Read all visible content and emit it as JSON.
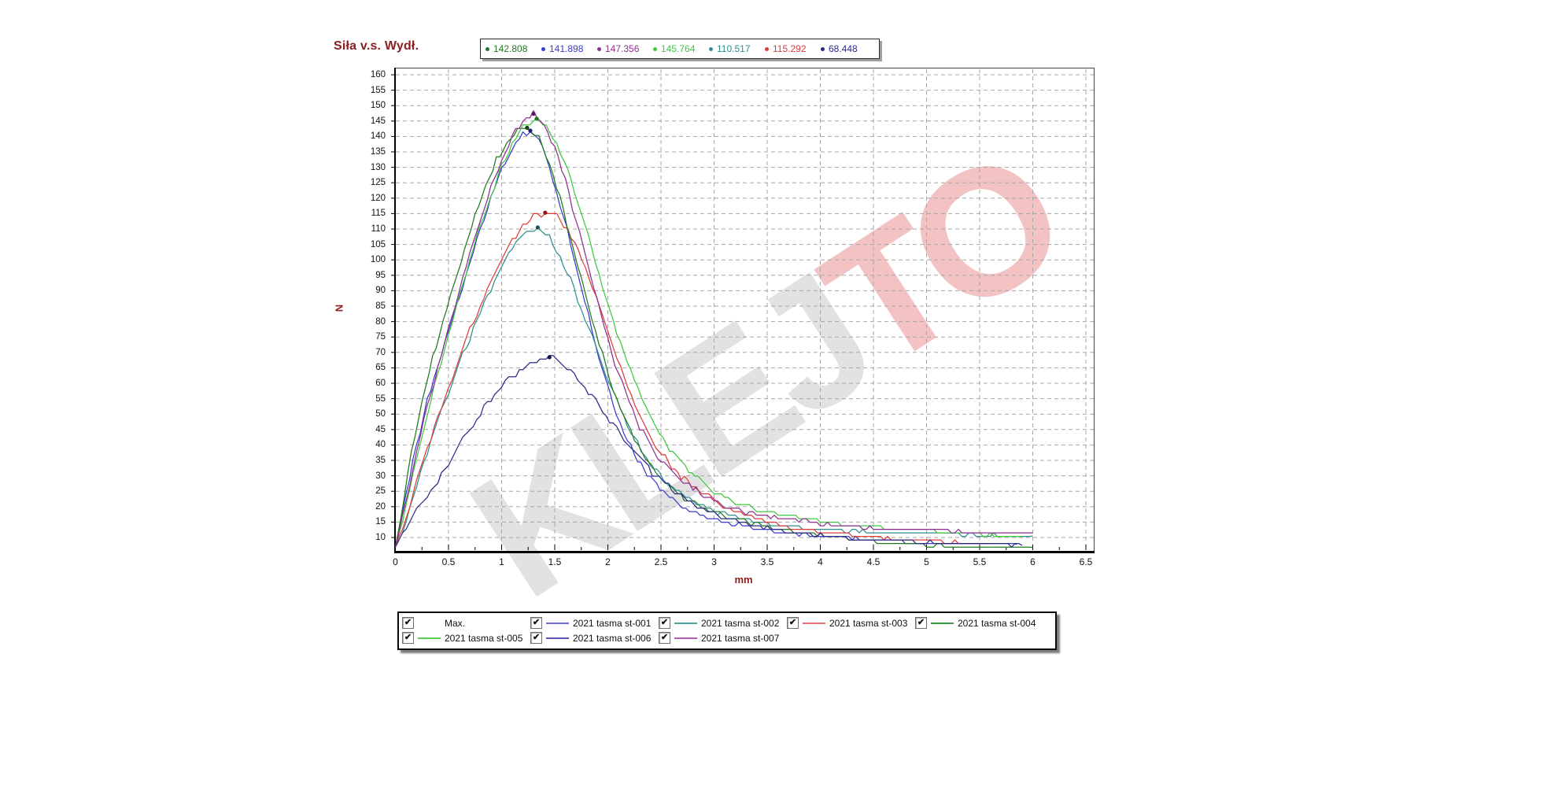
{
  "title": "Siła v.s. Wydł.",
  "values_bar": [
    {
      "value": "142.808",
      "color": "#217821"
    },
    {
      "value": "141.898",
      "color": "#3a3acc"
    },
    {
      "value": "147.356",
      "color": "#8f2f8f"
    },
    {
      "value": "145.764",
      "color": "#3fc93f"
    },
    {
      "value": "110.517",
      "color": "#2f8f8f"
    },
    {
      "value": "115.292",
      "color": "#e03a3a"
    },
    {
      "value": "68.448",
      "color": "#2b2b87"
    }
  ],
  "watermark": {
    "part1": "KLEJ",
    "part2": "TO"
  },
  "chart_data": {
    "type": "line",
    "title": "Siła v.s. Wydł.",
    "xlabel": "mm",
    "ylabel": "N",
    "xlim": [
      0,
      6.6
    ],
    "ylim": [
      5,
      162
    ],
    "grid": "dashed",
    "legend_position": "bottom",
    "x_ticks": [
      0,
      0.5,
      1,
      1.5,
      2,
      2.5,
      3,
      3.5,
      4,
      4.5,
      5,
      5.5,
      6,
      6.5
    ],
    "y_ticks": [
      10,
      15,
      20,
      25,
      30,
      35,
      40,
      45,
      50,
      55,
      60,
      65,
      70,
      75,
      80,
      85,
      90,
      95,
      100,
      105,
      110,
      115,
      120,
      125,
      130,
      135,
      140,
      145,
      150,
      155,
      160
    ],
    "series": [
      {
        "name": "2021 tasma st-001",
        "color": "#3a3acc",
        "marker_color": "#1b1b7a",
        "max": 141.898,
        "peak": [
          1.27,
          141.898
        ],
        "points": [
          [
            0,
            7
          ],
          [
            0.1,
            24
          ],
          [
            0.2,
            40
          ],
          [
            0.3,
            54
          ],
          [
            0.4,
            66
          ],
          [
            0.5,
            77
          ],
          [
            0.6,
            88
          ],
          [
            0.7,
            99
          ],
          [
            0.8,
            110
          ],
          [
            0.9,
            120
          ],
          [
            1.0,
            129
          ],
          [
            1.1,
            136
          ],
          [
            1.2,
            140.5
          ],
          [
            1.27,
            141.9
          ],
          [
            1.35,
            139
          ],
          [
            1.45,
            130
          ],
          [
            1.55,
            118
          ],
          [
            1.65,
            105
          ],
          [
            1.75,
            91
          ],
          [
            1.85,
            77
          ],
          [
            1.95,
            64
          ],
          [
            2.05,
            53
          ],
          [
            2.15,
            44
          ],
          [
            2.25,
            37
          ],
          [
            2.4,
            29
          ],
          [
            2.55,
            24
          ],
          [
            2.7,
            20
          ],
          [
            2.9,
            17
          ],
          [
            3.1,
            15
          ],
          [
            3.4,
            13
          ],
          [
            3.7,
            11.5
          ],
          [
            4.0,
            10.5
          ],
          [
            4.4,
            9.5
          ],
          [
            4.8,
            8.5
          ],
          [
            5.2,
            8
          ],
          [
            5.85,
            7.8
          ]
        ]
      },
      {
        "name": "2021 tasma st-002",
        "color": "#2f8f8f",
        "marker_color": "#1a5555",
        "max": 110.517,
        "peak": [
          1.34,
          110.517
        ],
        "points": [
          [
            0,
            7
          ],
          [
            0.1,
            15
          ],
          [
            0.2,
            27
          ],
          [
            0.3,
            38
          ],
          [
            0.4,
            48
          ],
          [
            0.5,
            57
          ],
          [
            0.6,
            66
          ],
          [
            0.7,
            75
          ],
          [
            0.8,
            83
          ],
          [
            0.9,
            91
          ],
          [
            1.0,
            98
          ],
          [
            1.1,
            104
          ],
          [
            1.2,
            108
          ],
          [
            1.34,
            110.5
          ],
          [
            1.45,
            107
          ],
          [
            1.55,
            101
          ],
          [
            1.65,
            93
          ],
          [
            1.75,
            84
          ],
          [
            1.85,
            75
          ],
          [
            1.95,
            66
          ],
          [
            2.05,
            57
          ],
          [
            2.15,
            49
          ],
          [
            2.25,
            42
          ],
          [
            2.4,
            34
          ],
          [
            2.55,
            28
          ],
          [
            2.7,
            24
          ],
          [
            2.9,
            20
          ],
          [
            3.1,
            17.5
          ],
          [
            3.4,
            15
          ],
          [
            3.7,
            13.5
          ],
          [
            4.0,
            12.5
          ],
          [
            4.4,
            12
          ],
          [
            4.8,
            11.5
          ],
          [
            5.3,
            11
          ],
          [
            6.0,
            10.5
          ]
        ]
      },
      {
        "name": "2021 tasma st-003",
        "color": "#e03a3a",
        "marker_color": "#8f1616",
        "max": 115.292,
        "peak": [
          1.41,
          115.292
        ],
        "points": [
          [
            0,
            7
          ],
          [
            0.1,
            16
          ],
          [
            0.2,
            28
          ],
          [
            0.3,
            39
          ],
          [
            0.4,
            49
          ],
          [
            0.5,
            58
          ],
          [
            0.6,
            68
          ],
          [
            0.7,
            77
          ],
          [
            0.8,
            85
          ],
          [
            0.9,
            93
          ],
          [
            1.0,
            100
          ],
          [
            1.1,
            106
          ],
          [
            1.2,
            111
          ],
          [
            1.3,
            114
          ],
          [
            1.41,
            115.3
          ],
          [
            1.52,
            114
          ],
          [
            1.62,
            110
          ],
          [
            1.72,
            103
          ],
          [
            1.82,
            95
          ],
          [
            1.92,
            85
          ],
          [
            2.02,
            75
          ],
          [
            2.12,
            65
          ],
          [
            2.22,
            56
          ],
          [
            2.32,
            48
          ],
          [
            2.45,
            40
          ],
          [
            2.6,
            33
          ],
          [
            2.75,
            28
          ],
          [
            2.95,
            23
          ],
          [
            3.15,
            19
          ],
          [
            3.45,
            15.5
          ],
          [
            3.75,
            13
          ],
          [
            4.1,
            11.5
          ],
          [
            4.5,
            10
          ],
          [
            4.9,
            9
          ],
          [
            5.3,
            8.5
          ],
          [
            5.6,
            8
          ]
        ]
      },
      {
        "name": "2021 tasma st-004",
        "color": "#217821",
        "marker_color": "#0f440f",
        "max": 142.808,
        "peak": [
          1.24,
          142.808
        ],
        "points": [
          [
            0,
            7
          ],
          [
            0.05,
            16
          ],
          [
            0.15,
            38
          ],
          [
            0.25,
            54
          ],
          [
            0.35,
            68
          ],
          [
            0.45,
            80
          ],
          [
            0.55,
            92
          ],
          [
            0.65,
            103
          ],
          [
            0.75,
            114
          ],
          [
            0.85,
            124
          ],
          [
            0.95,
            132
          ],
          [
            1.05,
            138
          ],
          [
            1.15,
            142
          ],
          [
            1.24,
            142.8
          ],
          [
            1.35,
            139
          ],
          [
            1.45,
            131
          ],
          [
            1.55,
            120
          ],
          [
            1.65,
            107
          ],
          [
            1.75,
            94
          ],
          [
            1.85,
            81
          ],
          [
            1.95,
            69
          ],
          [
            2.05,
            58
          ],
          [
            2.15,
            49
          ],
          [
            2.25,
            42
          ],
          [
            2.35,
            36
          ],
          [
            2.45,
            31
          ],
          [
            2.6,
            26
          ],
          [
            2.75,
            22
          ],
          [
            2.95,
            19
          ],
          [
            3.15,
            16.5
          ],
          [
            3.45,
            14
          ],
          [
            3.75,
            12
          ],
          [
            4.1,
            10.5
          ],
          [
            4.5,
            8.5
          ],
          [
            5.0,
            7.5
          ],
          [
            5.5,
            7
          ],
          [
            6.0,
            6.8
          ]
        ]
      },
      {
        "name": "2021 tasma st-005",
        "color": "#3fc93f",
        "marker_color": "#1a7a1a",
        "max": 145.764,
        "peak": [
          1.33,
          145.764
        ],
        "points": [
          [
            0,
            7
          ],
          [
            0.1,
            20
          ],
          [
            0.2,
            36
          ],
          [
            0.3,
            50
          ],
          [
            0.4,
            63
          ],
          [
            0.5,
            76
          ],
          [
            0.6,
            88
          ],
          [
            0.7,
            100
          ],
          [
            0.8,
            111
          ],
          [
            0.9,
            121
          ],
          [
            1.0,
            130
          ],
          [
            1.1,
            138
          ],
          [
            1.2,
            143
          ],
          [
            1.33,
            145.8
          ],
          [
            1.45,
            142
          ],
          [
            1.55,
            135
          ],
          [
            1.65,
            126
          ],
          [
            1.75,
            115
          ],
          [
            1.85,
            103
          ],
          [
            1.95,
            91
          ],
          [
            2.05,
            80
          ],
          [
            2.15,
            70
          ],
          [
            2.25,
            61
          ],
          [
            2.35,
            53
          ],
          [
            2.45,
            46
          ],
          [
            2.55,
            40
          ],
          [
            2.7,
            34
          ],
          [
            2.85,
            29
          ],
          [
            3.0,
            25
          ],
          [
            3.2,
            21.5
          ],
          [
            3.4,
            19
          ],
          [
            3.7,
            17
          ],
          [
            4.0,
            15.5
          ],
          [
            4.3,
            14
          ],
          [
            4.7,
            13
          ],
          [
            5.1,
            12
          ],
          [
            5.5,
            11
          ],
          [
            5.9,
            10.3
          ]
        ]
      },
      {
        "name": "2021 tasma st-006",
        "color": "#2b2b87",
        "marker_color": "#14144d",
        "max": 68.448,
        "peak": [
          1.45,
          68.448
        ],
        "points": [
          [
            0,
            7
          ],
          [
            0.1,
            13
          ],
          [
            0.2,
            19
          ],
          [
            0.3,
            24
          ],
          [
            0.4,
            28
          ],
          [
            0.5,
            34
          ],
          [
            0.6,
            40
          ],
          [
            0.7,
            45
          ],
          [
            0.8,
            50
          ],
          [
            0.9,
            55
          ],
          [
            1.0,
            59
          ],
          [
            1.1,
            62
          ],
          [
            1.2,
            65
          ],
          [
            1.3,
            67
          ],
          [
            1.45,
            68.4
          ],
          [
            1.55,
            67
          ],
          [
            1.65,
            64
          ],
          [
            1.75,
            60
          ],
          [
            1.85,
            56
          ],
          [
            1.95,
            51
          ],
          [
            2.05,
            47
          ],
          [
            2.15,
            42
          ],
          [
            2.25,
            38
          ],
          [
            2.35,
            34
          ],
          [
            2.45,
            30
          ],
          [
            2.6,
            26
          ],
          [
            2.75,
            22
          ],
          [
            2.9,
            19
          ],
          [
            3.1,
            16.5
          ],
          [
            3.3,
            14.5
          ],
          [
            3.6,
            12.5
          ],
          [
            3.9,
            11
          ],
          [
            4.2,
            10
          ],
          [
            4.6,
            9
          ],
          [
            5.0,
            8.5
          ],
          [
            5.4,
            8
          ],
          [
            5.9,
            7.5
          ]
        ]
      },
      {
        "name": "2021 tasma st-007",
        "color": "#8f2f8f",
        "marker_color": "#571a57",
        "max": 147.356,
        "peak": [
          1.3,
          147.356
        ],
        "points": [
          [
            0,
            7
          ],
          [
            0.1,
            22
          ],
          [
            0.2,
            38
          ],
          [
            0.3,
            52
          ],
          [
            0.4,
            65
          ],
          [
            0.5,
            78
          ],
          [
            0.6,
            90
          ],
          [
            0.7,
            102
          ],
          [
            0.8,
            113
          ],
          [
            0.9,
            123
          ],
          [
            1.0,
            132
          ],
          [
            1.1,
            140
          ],
          [
            1.2,
            145
          ],
          [
            1.3,
            147.4
          ],
          [
            1.4,
            144
          ],
          [
            1.5,
            136
          ],
          [
            1.6,
            126
          ],
          [
            1.7,
            113
          ],
          [
            1.8,
            100
          ],
          [
            1.9,
            87
          ],
          [
            2.0,
            74
          ],
          [
            2.1,
            63
          ],
          [
            2.2,
            54
          ],
          [
            2.3,
            46
          ],
          [
            2.4,
            40
          ],
          [
            2.5,
            35
          ],
          [
            2.65,
            30
          ],
          [
            2.8,
            26
          ],
          [
            3.0,
            22
          ],
          [
            3.2,
            19
          ],
          [
            3.5,
            17
          ],
          [
            3.8,
            15.5
          ],
          [
            4.1,
            14
          ],
          [
            4.5,
            13
          ],
          [
            4.9,
            12.5
          ],
          [
            5.3,
            12
          ],
          [
            5.7,
            11.7
          ],
          [
            6.0,
            11.5
          ]
        ]
      }
    ]
  },
  "legend": {
    "checkbox_glyph": "✔",
    "items": [
      {
        "label": "Max.",
        "line_color": null,
        "checked": true
      },
      {
        "label": "2021 tasma st-001",
        "line_color": "#6b6bd6",
        "checked": true
      },
      {
        "label": "2021 tasma st-002",
        "line_color": "#4fa0a0",
        "checked": true
      },
      {
        "label": "2021 tasma st-003",
        "line_color": "#e87070",
        "checked": true
      },
      {
        "label": "2021 tasma st-004",
        "line_color": "#3f9a3f",
        "checked": true
      },
      {
        "label": "2021 tasma st-005",
        "line_color": "#58d058",
        "checked": true
      },
      {
        "label": "2021 tasma st-006",
        "line_color": "#5656b0",
        "checked": true
      },
      {
        "label": "2021 tasma st-007",
        "line_color": "#b05ab0",
        "checked": true
      }
    ]
  }
}
